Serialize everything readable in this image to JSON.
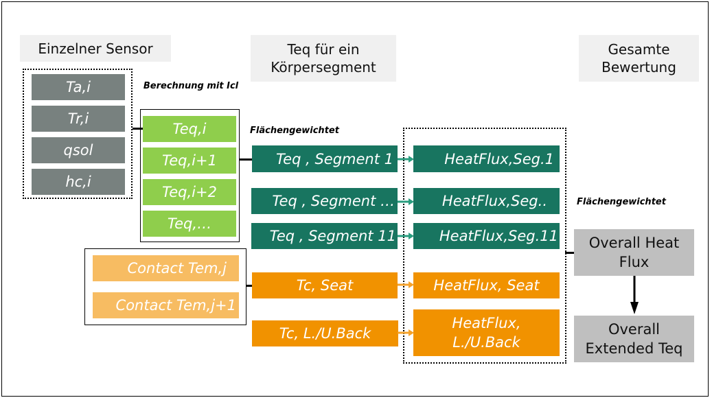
{
  "headers": {
    "sensor": "Einzelner Sensor",
    "segment": "Teq für ein Körpersegment",
    "overall": "Gesamte Bewertung"
  },
  "annotations": {
    "calc_with_icl": "Berechnung mit Icl",
    "area_weighted_1": "Flächengewichtet",
    "area_weighted_2": "Flächengewichtet"
  },
  "sensor_inputs": [
    "Ta,i",
    "Tr,i",
    "qsol",
    "hc,i"
  ],
  "teq_local": [
    "Teq,i",
    "Teq,i+1",
    "Teq,i+2",
    "Teq,…"
  ],
  "contact_temps": [
    "Contact Tem,j",
    "Contact Tem,j+1"
  ],
  "segments": [
    "Teq , Segment 1",
    "Teq , Segment …",
    "Teq , Segment 11"
  ],
  "contact_segments": [
    "Tc, Seat",
    "Tc, L./U.Back"
  ],
  "heat_flux": [
    "HeatFlux,Seg.1",
    "HeatFlux,Seg..",
    "HeatFlux,Seg.11",
    "HeatFlux, Seat",
    "HeatFlux, L./U.Back"
  ],
  "results": {
    "overall_heat_flux": "Overall Heat Flux",
    "overall_extended_teq": "Overall Extended Teq"
  },
  "colors": {
    "sensor_gray": "#78817f",
    "teq_light_green": "#8fce4c",
    "segment_dark_green": "#187560",
    "contact_orange": "#f19200",
    "contact_light_orange": "#f7bc62",
    "result_gray": "#bfbfbf",
    "header_bg": "#f0f0f0"
  }
}
